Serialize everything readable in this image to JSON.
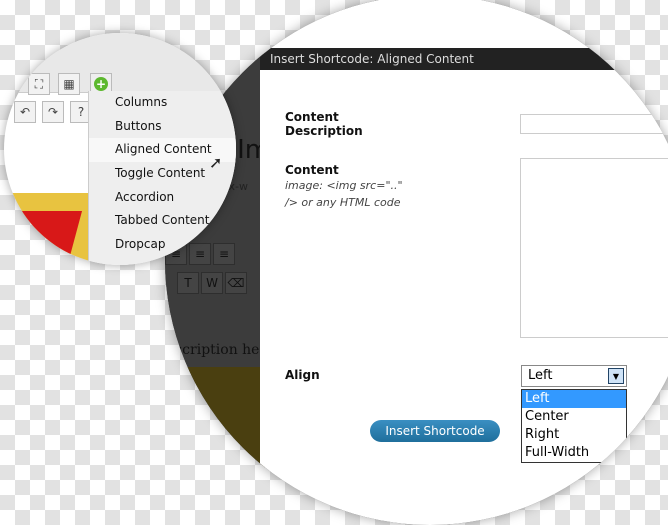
{
  "menu": {
    "items": [
      "Columns",
      "Buttons",
      "Aligned Content",
      "Toggle Content",
      "Accordion",
      "Tabbed Content",
      "Dropcap"
    ],
    "highlighted": "Aligned Content"
  },
  "editor": {
    "heading_fragment": "(Im",
    "slug_fragment": "dex-w",
    "description_fragment": "scription he"
  },
  "modal": {
    "title": "Insert Shortcode: Aligned Content",
    "content_description_label": "Content Description",
    "content_label": "Content",
    "content_hint": "image: <img src=\"..\" /> or any HTML code",
    "align_label": "Align",
    "align_value": "Left",
    "align_options": [
      "Left",
      "Center",
      "Right",
      "Full-Width"
    ],
    "insert_button": "Insert Shortcode"
  },
  "colors": {
    "accent": "#3399ff",
    "button": "#2a7fb0",
    "add_icon": "#5cb82e"
  }
}
